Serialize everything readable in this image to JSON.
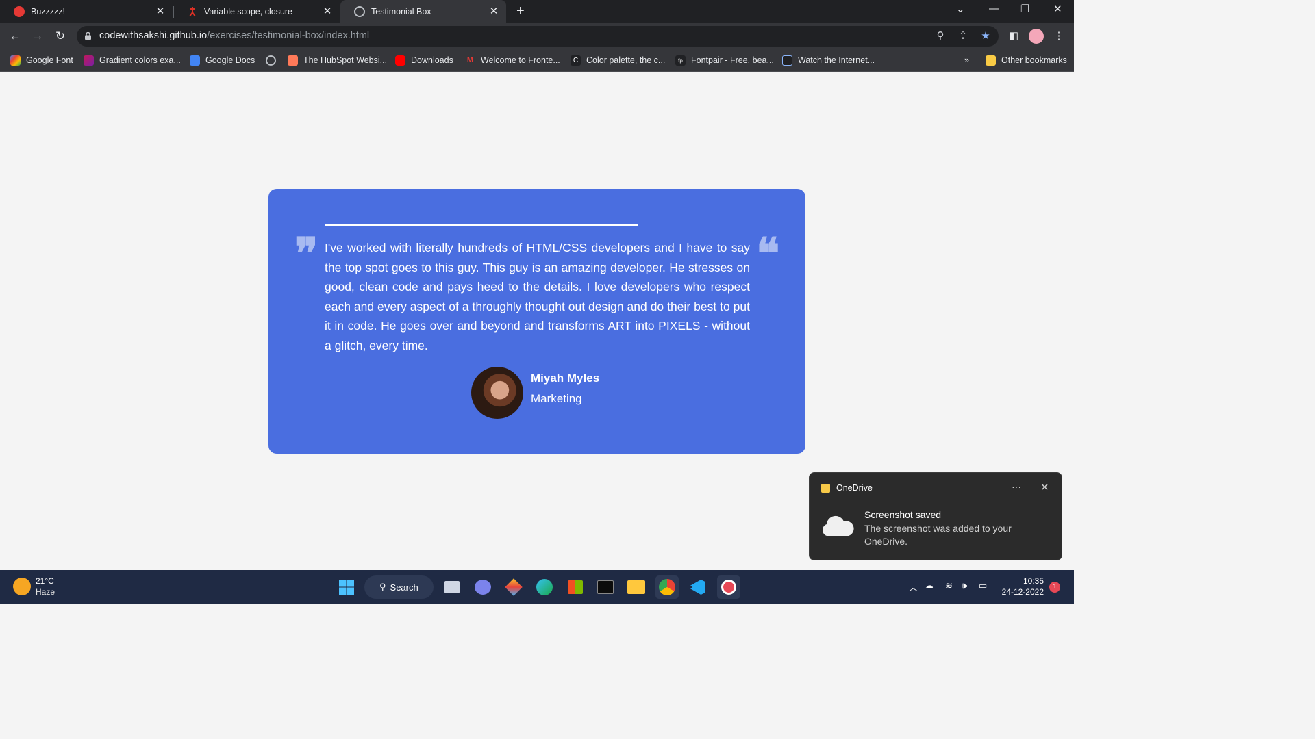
{
  "browser": {
    "tabs": [
      {
        "title": "Buzzzzz!",
        "active": false
      },
      {
        "title": "Variable scope, closure",
        "active": false
      },
      {
        "title": "Testimonial Box",
        "active": true
      }
    ],
    "url_host": "codewithsakshi.github.io",
    "url_path": "/exercises/testimonial-box/index.html",
    "bookmarks": [
      "Google Font",
      "Gradient colors exa...",
      "Google Docs",
      "The HubSpot Websi...",
      "Downloads",
      "Welcome to Fronte...",
      "Color palette, the c...",
      "Fontpair - Free, bea...",
      "Watch the Internet..."
    ],
    "bookmarks_overflow": "»",
    "other_bookmarks": "Other bookmarks"
  },
  "testimonial": {
    "quote": "I've worked with literally hundreds of HTML/CSS developers and I have to say the top spot goes to this guy. This guy is an amazing developer. He stresses on good, clean code and pays heed to the details. I love developers who respect each and every aspect of a throughly thought out design and do their best to put it in code. He goes over and beyond and transforms ART into PIXELS - without a glitch, every time.",
    "name": "Miyah Myles",
    "role": "Marketing",
    "accent_color": "#4a6ee0"
  },
  "toast": {
    "app": "OneDrive",
    "title": "Screenshot saved",
    "message": "The screenshot was added to your OneDrive."
  },
  "taskbar": {
    "temperature": "21°C",
    "weather": "Haze",
    "search_label": "Search",
    "time": "10:35",
    "date": "24-12-2022",
    "notification_count": "1"
  }
}
